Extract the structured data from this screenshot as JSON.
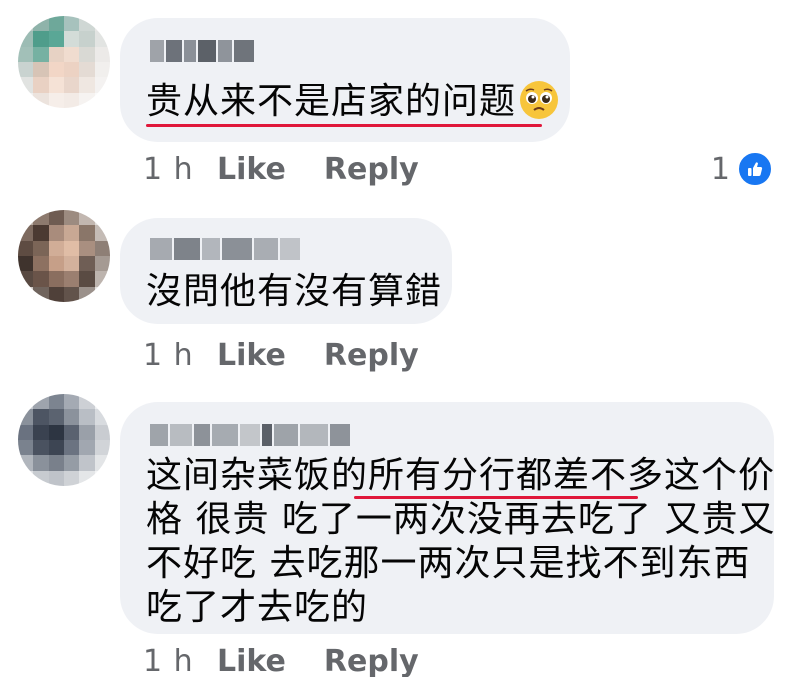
{
  "comments": [
    {
      "text": "贵从来不是店家的问题",
      "emoji": "pleading-face-emoji",
      "time": "1 h",
      "like_label": "Like",
      "reply_label": "Reply",
      "reaction_count": "1",
      "reaction_icon": "thumbs-up-icon"
    },
    {
      "text": "沒問他有沒有算錯",
      "time": "1 h",
      "like_label": "Like",
      "reply_label": "Reply"
    },
    {
      "lines": [
        "这间杂菜饭的所有分行都差不多这个价",
        "格 很贵 吃了一两次没再去吃了 又贵又",
        "不好吃 去吃那一两次只是找不到东西",
        "吃了才去吃的"
      ],
      "time": "1 h",
      "like_label": "Like",
      "reply_label": "Reply"
    }
  ],
  "colors": {
    "bubble": "#eff1f5",
    "meta_text": "#65676b",
    "underline": "#e0173a",
    "like_blue": "#1877f2"
  }
}
